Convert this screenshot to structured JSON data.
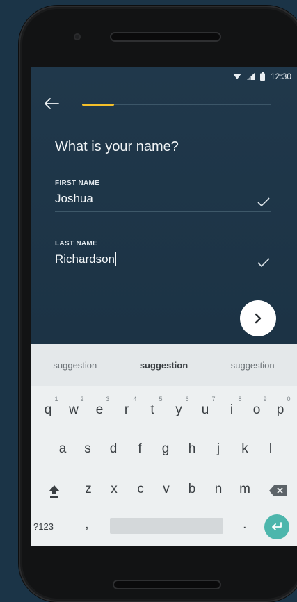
{
  "status_bar": {
    "time": "12:30"
  },
  "progress": {
    "fraction": 0.17
  },
  "question": "What is your name?",
  "fields": [
    {
      "label": "FIRST NAME",
      "value": "Joshua",
      "valid": true
    },
    {
      "label": "LAST NAME",
      "value": "Richardson",
      "valid": true
    }
  ],
  "keyboard": {
    "suggestions": [
      "suggestion",
      "suggestion",
      "suggestion"
    ],
    "row1": [
      "q",
      "w",
      "e",
      "r",
      "t",
      "y",
      "u",
      "i",
      "o",
      "p"
    ],
    "row1_hints": [
      "1",
      "2",
      "3",
      "4",
      "5",
      "6",
      "7",
      "8",
      "9",
      "0"
    ],
    "row2": [
      "a",
      "s",
      "d",
      "f",
      "g",
      "h",
      "j",
      "k",
      "l"
    ],
    "row3": [
      "z",
      "x",
      "c",
      "v",
      "b",
      "n",
      "m"
    ],
    "symbols_label": "?123",
    "comma": ",",
    "period": "."
  },
  "colors": {
    "accent": "#f3bf2a",
    "enter": "#4db6ac",
    "screen_bg": "#1f374a"
  },
  "icons": {
    "back": "arrow-left-icon",
    "next": "chevron-right-icon",
    "check": "check-icon",
    "shift": "shift-icon",
    "backspace": "backspace-icon",
    "enter": "enter-icon"
  }
}
